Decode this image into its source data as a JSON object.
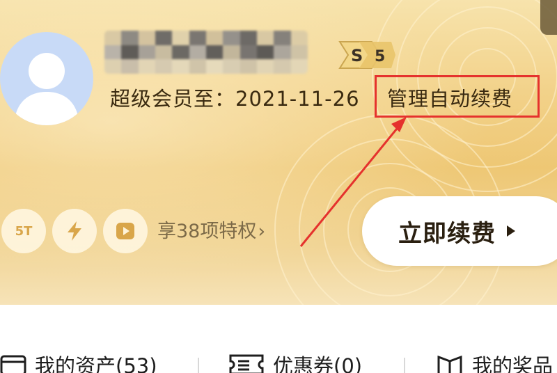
{
  "profile": {
    "vip_text": "超级会员至：2021-11-26",
    "manage_link": "管理自动续费",
    "level_letter": "S",
    "level_number": "5"
  },
  "perks": {
    "badge_5t": "5T",
    "summary": "享38项特权",
    "chevron": "›"
  },
  "renew_button": {
    "label": "立即续费"
  },
  "assets": [
    {
      "label": "我的资产(53)"
    },
    {
      "label": "优惠券(0)"
    },
    {
      "label": "我的奖品"
    }
  ],
  "colors": {
    "gold": "#f2d188",
    "annotation_red": "#e5322d",
    "avatar_bg": "#c8daf7"
  }
}
